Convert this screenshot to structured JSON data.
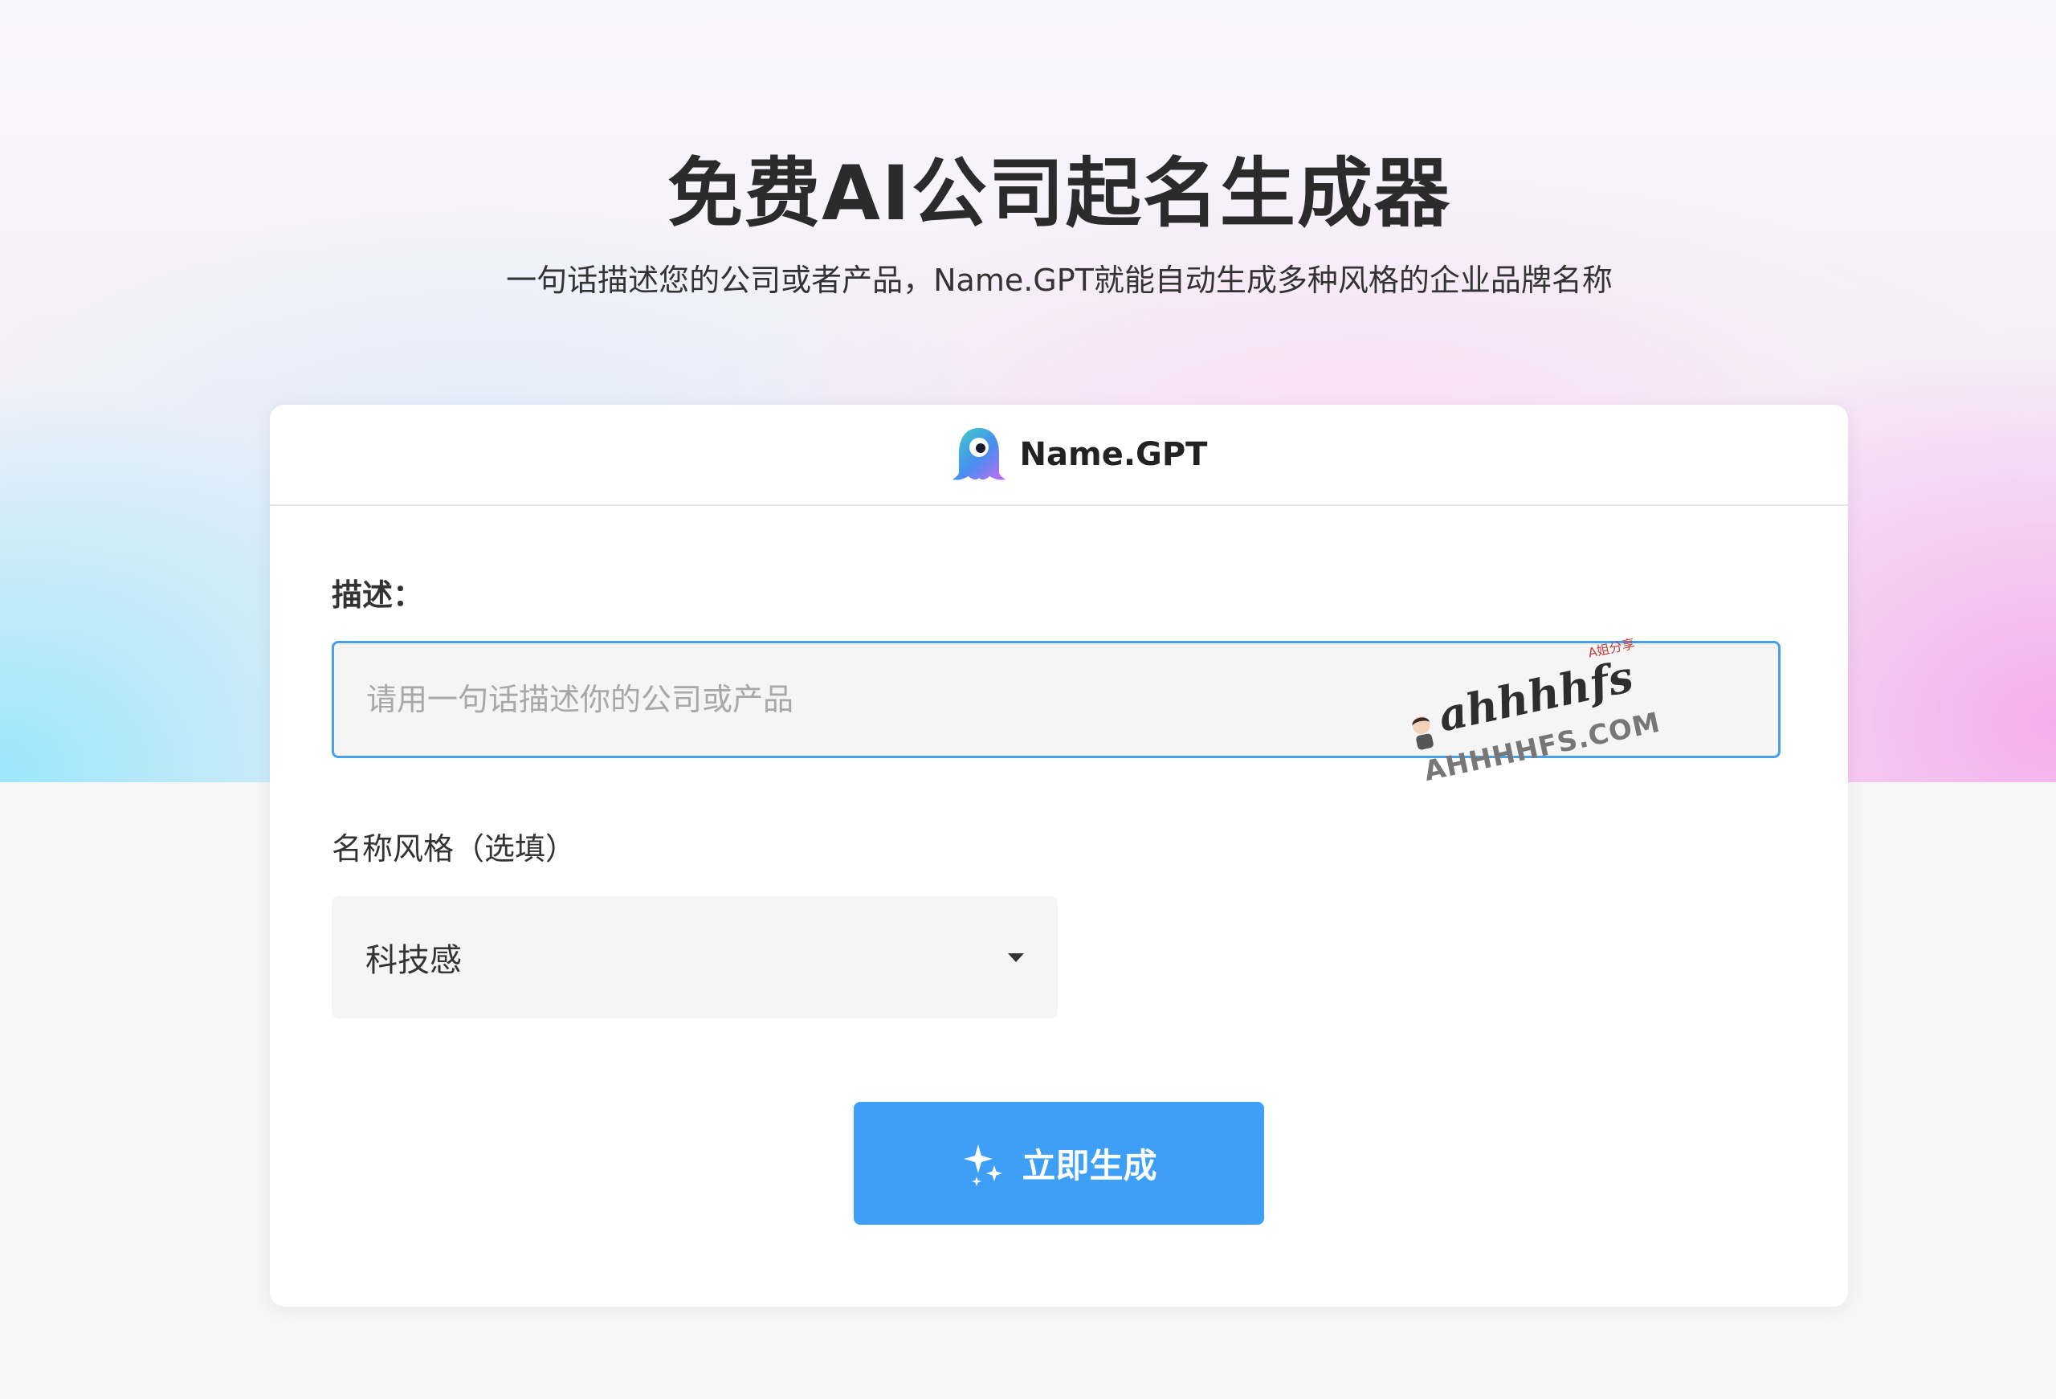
{
  "page": {
    "title": "免费AI公司起名生成器",
    "subtitle": "一句话描述您的公司或者产品，Name.GPT就能自动生成多种风格的企业品牌名称"
  },
  "card": {
    "brand_name": "Name.GPT",
    "logo_icon": "ghost-logo-icon",
    "description": {
      "label": "描述：",
      "value": "",
      "placeholder": "请用一句话描述你的公司或产品"
    },
    "style": {
      "label": "名称风格（选填）",
      "selected": "科技感"
    },
    "generate_button": {
      "label": "立即生成",
      "icon": "sparkle-icon"
    }
  },
  "watermark": {
    "main": "ahhhhfs",
    "small": "A姐分享",
    "domain": "AHHHHFS.COM"
  },
  "colors": {
    "accent": "#3d9ff5",
    "input_border": "#4aa0e6",
    "text": "#2b2b2b"
  }
}
